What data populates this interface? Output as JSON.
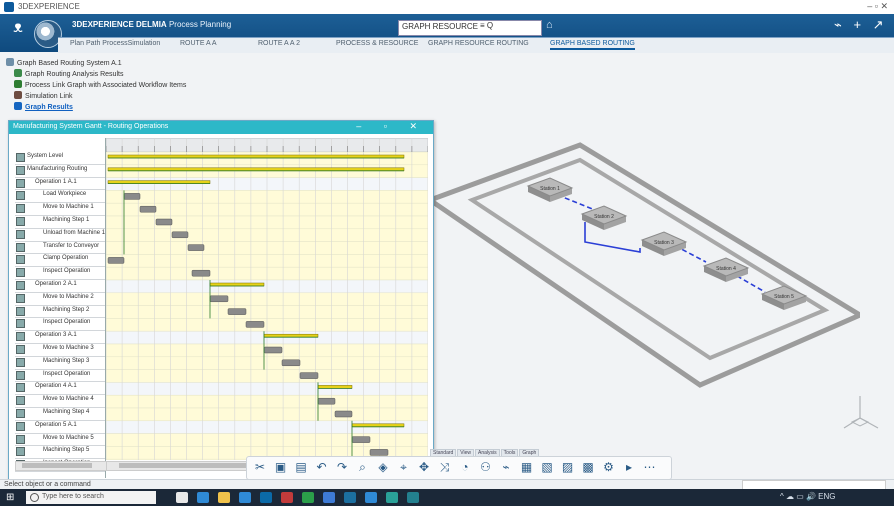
{
  "window": {
    "title": "3DEXPERIENCE",
    "controls": "– ▫ ✕"
  },
  "ribbon": {
    "brand_prefix": "3DEXPERIENCE",
    "brand_app": "DELMIA",
    "brand_suffix": "Process Planning",
    "search_value": "GRAPH RESOURCE",
    "search_buttons": "≡ Q",
    "user_line1": "",
    "user_line2": "",
    "right_icons": "⌁ + ↗ ⟳",
    "colors": {
      "ribbon": "#0f4a7e",
      "accent": "#0d5a9c",
      "gantt_header": "#2db8c8"
    }
  },
  "tabs": [
    {
      "label": "Plan Path ProcessSimulation",
      "active": false
    },
    {
      "label": "ROUTE A A",
      "active": false
    },
    {
      "label": "ROUTE A A 2",
      "active": false
    },
    {
      "label": "PROCESS & RESOURCE",
      "active": false
    },
    {
      "label": "GRAPH RESOURCE ROUTING",
      "active": false
    },
    {
      "label": "GRAPH BASED ROUTING",
      "active": true
    }
  ],
  "tree": [
    {
      "label": "Graph Based Routing System A.1",
      "icon": "#6f8fa8",
      "link": false
    },
    {
      "label": "Graph Routing Analysis Results",
      "icon": "#3b8a4a",
      "link": false
    },
    {
      "label": "Process Link Graph with Associated Workflow Items",
      "icon": "#2e7d32",
      "link": false
    },
    {
      "label": "Simulation Link",
      "icon": "#6d4c41",
      "link": false
    },
    {
      "label": "Graph Results",
      "icon": "#1565c0",
      "link": true
    }
  ],
  "gantt": {
    "title": "Manufacturing System Gantt - Routing Operations",
    "controls": "– ▫ ✕",
    "rows": [
      {
        "indent": 0,
        "label": "System Level"
      },
      {
        "indent": 0,
        "label": "Manufacturing Routing"
      },
      {
        "indent": 1,
        "label": "Operation 1 A.1"
      },
      {
        "indent": 2,
        "label": "Load Workpiece"
      },
      {
        "indent": 2,
        "label": "Move to Machine 1"
      },
      {
        "indent": 2,
        "label": "Machining Step 1"
      },
      {
        "indent": 2,
        "label": "Unload from Machine 1"
      },
      {
        "indent": 2,
        "label": "Transfer to Conveyor"
      },
      {
        "indent": 2,
        "label": "Clamp Operation"
      },
      {
        "indent": 2,
        "label": "Inspect Operation"
      },
      {
        "indent": 1,
        "label": "Operation 2 A.1"
      },
      {
        "indent": 2,
        "label": "Move to Machine 2"
      },
      {
        "indent": 2,
        "label": "Machining Step 2"
      },
      {
        "indent": 2,
        "label": "Inspect Operation"
      },
      {
        "indent": 1,
        "label": "Operation 3 A.1"
      },
      {
        "indent": 2,
        "label": "Move to Machine 3"
      },
      {
        "indent": 2,
        "label": "Machining Step 3"
      },
      {
        "indent": 2,
        "label": "Inspect Operation"
      },
      {
        "indent": 1,
        "label": "Operation 4 A.1"
      },
      {
        "indent": 2,
        "label": "Move to Machine 4"
      },
      {
        "indent": 2,
        "label": "Machining Step 4"
      },
      {
        "indent": 1,
        "label": "Operation 5 A.1"
      },
      {
        "indent": 2,
        "label": "Move to Machine 5"
      },
      {
        "indent": 2,
        "label": "Machining Step 5"
      },
      {
        "indent": 2,
        "label": "Inspect Operation"
      }
    ]
  },
  "scene": {
    "stations": [
      "Station 1",
      "Station 2",
      "Station 3",
      "Station 4",
      "Station 5"
    ]
  },
  "command_tabs": [
    "Standard",
    "View",
    "Analysis",
    "Tools",
    "Graph"
  ],
  "status_text": "Select object or a command",
  "taskbar": {
    "search_placeholder": "Type here to search",
    "tray": "^ ☁ ▭ 🔊 ENG",
    "time": "",
    "date": ""
  }
}
